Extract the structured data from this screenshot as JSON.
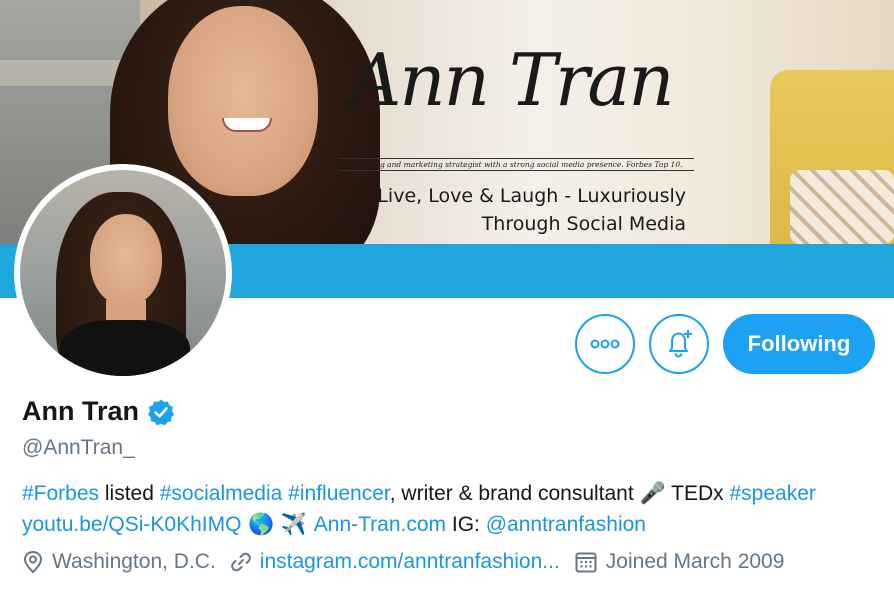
{
  "banner": {
    "logo_text": "Ann Tran",
    "tagline": "Branding and marketing strategist with a strong social media presence. Forbes Top 10.",
    "motto_line1": "Live, Love & Laugh - Luxuriously",
    "motto_line2": "Through Social Media",
    "accent_color": "#1fa6dc"
  },
  "actions": {
    "more_icon": "more-dots-icon",
    "notify_icon": "bell-plus-icon",
    "follow_label": "Following",
    "brand_color": "#1da1f2"
  },
  "profile": {
    "name": "Ann Tran",
    "verified_icon": "verified-badge-icon",
    "handle": "@AnnTran_",
    "bio": {
      "line1": [
        {
          "text": "#Forbes",
          "link": true
        },
        {
          "text": " listed ",
          "link": false
        },
        {
          "text": "#socialmedia",
          "link": true
        },
        {
          "text": " ",
          "link": false
        },
        {
          "text": "#influencer",
          "link": true
        },
        {
          "text": ", writer & brand consultant ",
          "link": false
        },
        {
          "text": "🎤",
          "link": false
        },
        {
          "text": " TEDx ",
          "link": false
        },
        {
          "text": "#speaker",
          "link": true
        }
      ],
      "line2": [
        {
          "text": "youtu.be/QSi-K0KhIMQ",
          "link": true
        },
        {
          "text": " 🌎 ✈️ ",
          "link": false
        },
        {
          "text": "Ann-Tran.com",
          "link": true
        },
        {
          "text": " IG: ",
          "link": false
        },
        {
          "text": "@anntranfashion",
          "link": true
        }
      ]
    },
    "location": "Washington, D.C.",
    "website": "instagram.com/anntranfashion...",
    "joined": "Joined March 2009"
  }
}
